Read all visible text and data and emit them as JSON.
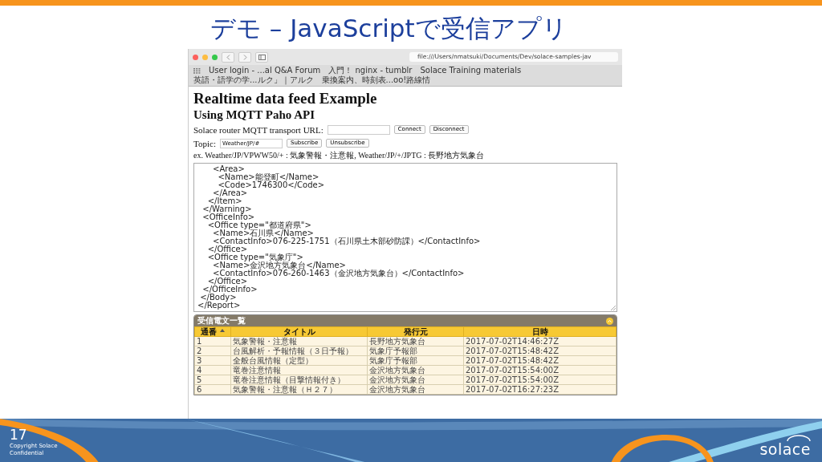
{
  "slide": {
    "title": "デモ – JavaScriptで受信アプリ",
    "page_number": "17",
    "copyright": [
      "Copyright Solace",
      "Confidential"
    ],
    "logo": "solace"
  },
  "browser": {
    "url": "file:///Users/nmatsuki/Documents/Dev/solace-samples-jav",
    "bookmarks": [
      "User login - ...al Q&A Forum",
      "入門！ nginx - tumblr",
      "Solace Training materials",
      "英語・語学の学...ルク」｜アルク",
      "乗換案内、時刻表...oo!路線情"
    ],
    "page": {
      "heading": "Realtime data feed Example",
      "subheading": "Using MQTT Paho API",
      "url_label": "Solace router MQTT transport URL:",
      "connect_buttons": [
        "Connect",
        "Disconnect"
      ],
      "topic_label": "Topic:",
      "topic_value": "Weather/JP/#",
      "subscribe_buttons": [
        "Subscribe",
        "Unsubscribe"
      ],
      "example": "ex. Weather/JP/VPWW50/+ : 気象警報・注意報, Weather/JP/+/JPTG : 長野地方気象台",
      "message_lines": [
        "      <Area>",
        "        <Name>能登町</Name>",
        "        <Code>1746300</Code>",
        "      </Area>",
        "    </Item>",
        "  </Warning>",
        "  <OfficeInfo>",
        "    <Office type=\"都道府県\">",
        "      <Name>石川県</Name>",
        "      <ContactInfo>076-225-1751（石川県土木部砂防課）</ContactInfo>",
        "    </Office>",
        "    <Office type=\"気象庁\">",
        "      <Name>金沢地方気象台</Name>",
        "      <ContactInfo>076-260-1463（金沢地方気象台）</ContactInfo>",
        "    </Office>",
        "  </OfficeInfo>",
        " </Body>",
        "</Report>"
      ],
      "table": {
        "title": "受信電文一覧",
        "columns": [
          {
            "label": "通番",
            "sorted": true
          },
          {
            "label": "タイトル",
            "sorted": false
          },
          {
            "label": "発行元",
            "sorted": false
          },
          {
            "label": "日時",
            "sorted": false
          }
        ],
        "rows": [
          [
            "1",
            "気象警報・注意報",
            "長野地方気象台",
            "2017-07-02T14:46:27Z"
          ],
          [
            "2",
            "台風解析・予報情報（３日予報）",
            "気象庁予報部",
            "2017-07-02T15:48:42Z"
          ],
          [
            "3",
            "全般台風情報（定型）",
            "気象庁予報部",
            "2017-07-02T15:48:42Z"
          ],
          [
            "4",
            "竜巻注意情報",
            "金沢地方気象台",
            "2017-07-02T15:54:00Z"
          ],
          [
            "5",
            "竜巻注意情報（目撃情報付き）",
            "金沢地方気象台",
            "2017-07-02T15:54:00Z"
          ],
          [
            "6",
            "気象警報・注意報（Ｈ２７）",
            "金沢地方気象台",
            "2017-07-02T16:27:23Z"
          ]
        ]
      }
    }
  }
}
